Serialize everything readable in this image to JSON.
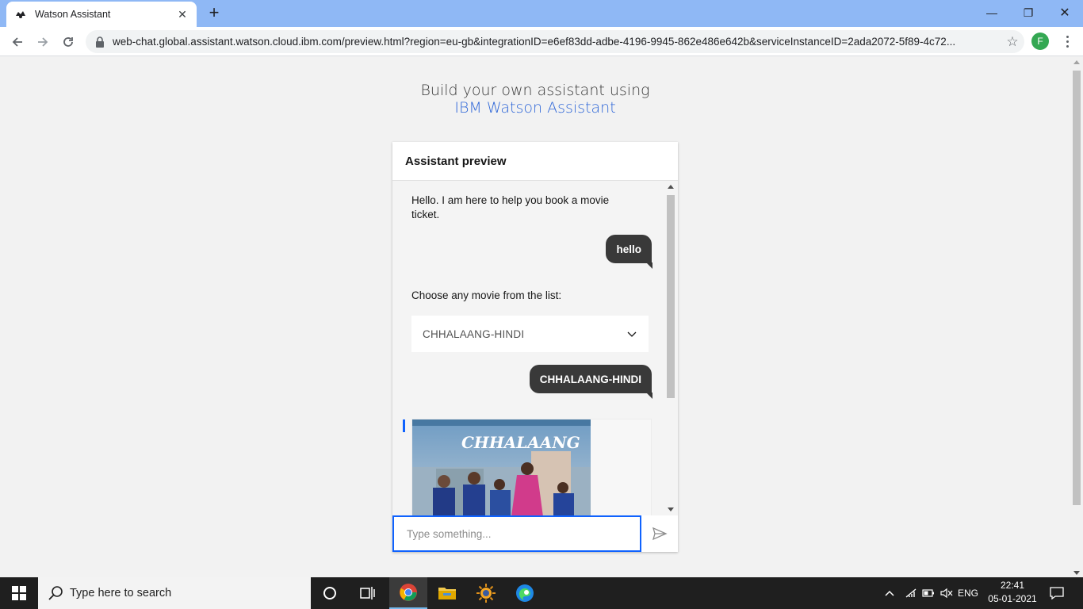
{
  "browser": {
    "tab_title": "Watson Assistant",
    "url": "web-chat.global.assistant.watson.cloud.ibm.com/preview.html?region=eu-gb&integrationID=e6ef83dd-adbe-4196-9945-862e486e642b&serviceInstanceID=2ada2072-5f89-4c72...",
    "profile_initial": "F"
  },
  "promo": {
    "line1": "Build your own assistant using",
    "brand": "IBM Watson Assistant"
  },
  "chat": {
    "header_title": "Assistant preview",
    "messages": [
      {
        "from": "bot",
        "text": "Hello. I am here to help you book a movie ticket."
      },
      {
        "from": "user",
        "text": "hello"
      },
      {
        "from": "bot",
        "text": "Choose any movie from the list:"
      },
      {
        "from": "user",
        "text": "CHHALAANG-HINDI"
      }
    ],
    "dropdown_value": "CHHALAANG-HINDI",
    "poster_title": "CHHALAANG",
    "input_placeholder": "Type something..."
  },
  "taskbar": {
    "search_placeholder": "Type here to search",
    "language": "ENG",
    "time": "22:41",
    "date": "05-01-2021"
  },
  "colors": {
    "accent": "#0f62fe",
    "user_bubble": "#393939",
    "profile": "#34a853"
  }
}
